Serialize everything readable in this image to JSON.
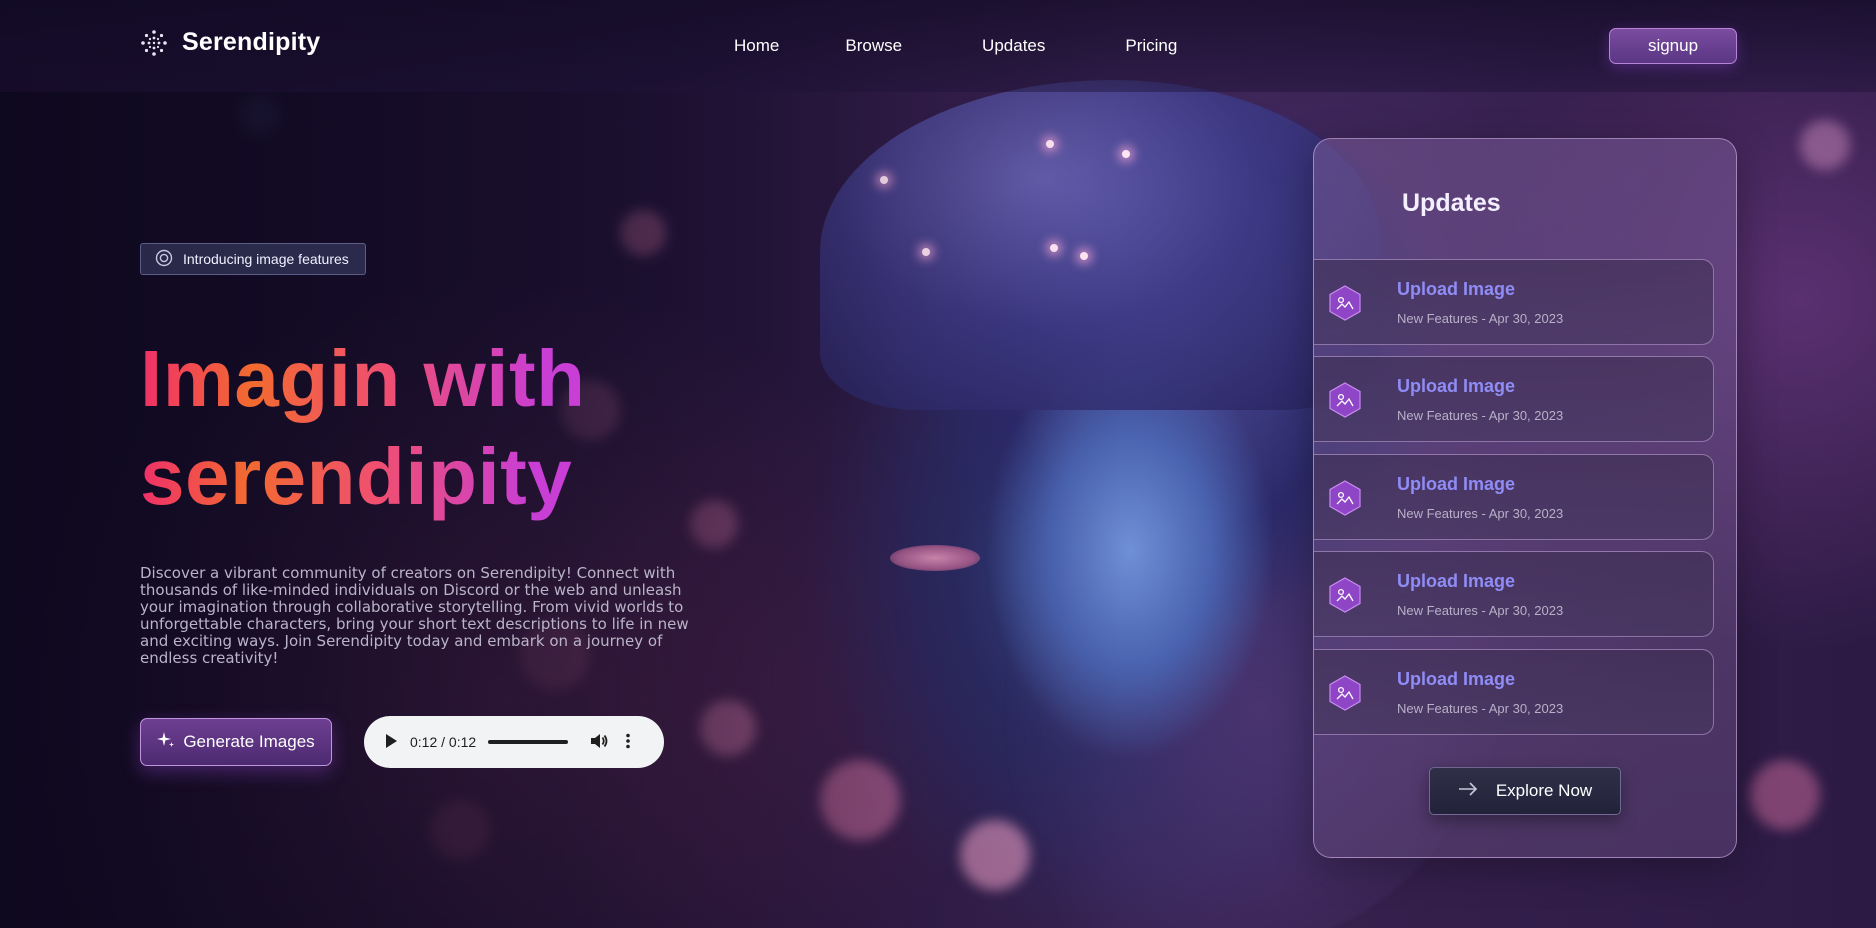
{
  "brand": {
    "name": "Serendipity",
    "logo_icon": "dots-grid-icon"
  },
  "nav": {
    "items": [
      "Home",
      "Browse",
      "Updates",
      "Pricing"
    ]
  },
  "signup_label": "signup",
  "hero": {
    "badge": "Introducing image features",
    "title_line1": "Imagin with",
    "title_line2": "serendipity",
    "description": "Discover a vibrant community of creators on Serendipity! Connect with thousands of like-minded individuals on Discord or the web and unleash your imagination through collaborative storytelling. From vivid worlds to unforgettable characters, bring your short text descriptions to life in new and exciting ways. Join Serendipity today and embark on a journey of endless creativity!",
    "generate_label": "Generate Images",
    "audio_time": "0:12 / 0:12"
  },
  "updates": {
    "title": "Updates",
    "items": [
      {
        "title": "Upload Image",
        "subtitle": "New Features - Apr 30, 2023"
      },
      {
        "title": "Upload Image",
        "subtitle": "New Features - Apr 30, 2023"
      },
      {
        "title": "Upload Image",
        "subtitle": "New Features - Apr 30, 2023"
      },
      {
        "title": "Upload Image",
        "subtitle": "New Features - Apr 30, 2023"
      },
      {
        "title": "Upload Image",
        "subtitle": "New Features - Apr 30, 2023"
      }
    ],
    "explore_label": "Explore Now"
  },
  "colors": {
    "accent": "#8f8cf6",
    "brand_purple": "#6e3f92",
    "title_pink": "#f0306a",
    "title_orange": "#f26a30",
    "title_magenta": "#c93ed4"
  }
}
